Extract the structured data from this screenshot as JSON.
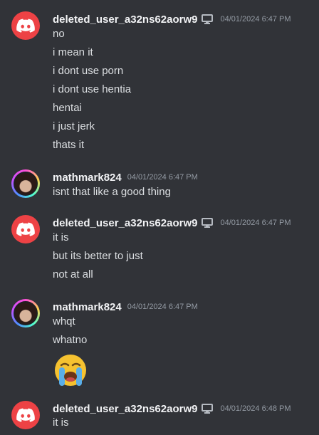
{
  "groups": [
    {
      "user": "deleted_user_a32ns62aorw9",
      "avatar": "discord-logo-icon",
      "platform_icon": "desktop-icon",
      "time": "04/01/2024 6:47 PM",
      "messages": [
        "no",
        "i mean it",
        "i dont use porn",
        "i dont use hentia",
        "hentai",
        "i just jerk",
        "thats it"
      ]
    },
    {
      "user": "mathmark824",
      "avatar": "user-photo-avatar",
      "time": "04/01/2024 6:47 PM",
      "messages": [
        "isnt that like a good thing"
      ]
    },
    {
      "user": "deleted_user_a32ns62aorw9",
      "avatar": "discord-logo-icon",
      "platform_icon": "desktop-icon",
      "time": "04/01/2024 6:47 PM",
      "messages": [
        "it is",
        "but its better to just",
        "not at all"
      ]
    },
    {
      "user": "mathmark824",
      "avatar": "user-photo-avatar",
      "time": "04/01/2024 6:47 PM",
      "messages": [
        "whqt",
        "whatno"
      ],
      "emoji": "loudly-crying-face-emoji"
    },
    {
      "user": "deleted_user_a32ns62aorw9",
      "avatar": "discord-logo-icon",
      "platform_icon": "desktop-icon",
      "time": "04/01/2024 6:48 PM",
      "messages": [
        "it is"
      ]
    }
  ]
}
